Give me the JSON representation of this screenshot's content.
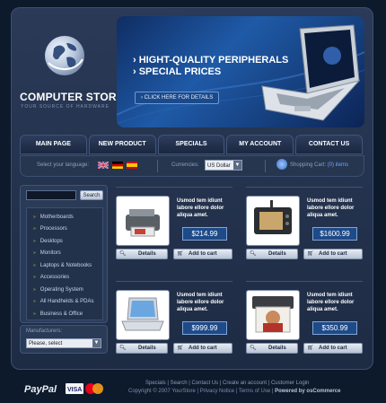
{
  "store": {
    "name": "COMPUTER STORE",
    "tagline": "YOUR SOURCE OF HARDWARE"
  },
  "banner": {
    "line1": "› HIGHT-QUALITY PERIPHERALS",
    "line2": "› SPECIAL PRICES",
    "cta": "› CLICK HERE FOR DETAILS"
  },
  "nav": [
    {
      "label": "MAIN PAGE"
    },
    {
      "label": "NEW PRODUCT"
    },
    {
      "label": "SPECIALS"
    },
    {
      "label": "MY ACCOUNT"
    },
    {
      "label": "CONTACT US"
    }
  ],
  "toolbar": {
    "language_label": "Select your language:",
    "currency_label": "Currencies:",
    "currency_value": "US Dollar",
    "cart_label": "Shopping Cart:",
    "cart_count": "(0) items"
  },
  "search": {
    "button": "Search"
  },
  "categories": [
    "Motherboards",
    "Processors",
    "Desktops",
    "Monitors",
    "Laptops & Notebooks",
    "Accessories",
    "Operating System",
    "All Handhelds & PDAs",
    "Business & Office"
  ],
  "manufacturers": {
    "label": "Manufacturers:",
    "value": "Please, select"
  },
  "products": [
    {
      "desc": "Usmod tem idiunt labore ellore dolor aliqua amet.",
      "price": "$214.99",
      "details": "Details",
      "add": "Add to cart",
      "icon": "printer"
    },
    {
      "desc": "Usmod tem idiunt labore ellore dolor aliqua amet.",
      "price": "$1600.99",
      "details": "Details",
      "add": "Add to cart",
      "icon": "handheld-pc"
    },
    {
      "desc": "Usmod tem idiunt labore ellore dolor aliqua amet.",
      "price": "$999.99",
      "details": "Details",
      "add": "Add to cart",
      "icon": "laptop"
    },
    {
      "desc": "Usmod tem idiunt labore ellore dolor aliqua amet.",
      "price": "$350.99",
      "details": "Details",
      "add": "Add to cart",
      "icon": "photo-printer"
    }
  ],
  "footer": {
    "links": "Specials  |  Search  |  Contact Us  |  Create an account  |  Customer Login",
    "copyright": "Copyright © 2007 YourStore | Privacy Notice | Terms of Use | ",
    "powered": "Powered by osCommerce"
  },
  "payment": {
    "paypal": "PayPal",
    "visa": "VISA"
  },
  "colors": {
    "background": "#0d1a2c",
    "panel": "#2a3a57",
    "accent": "#1e4a88",
    "bullet": "#d3b533"
  }
}
